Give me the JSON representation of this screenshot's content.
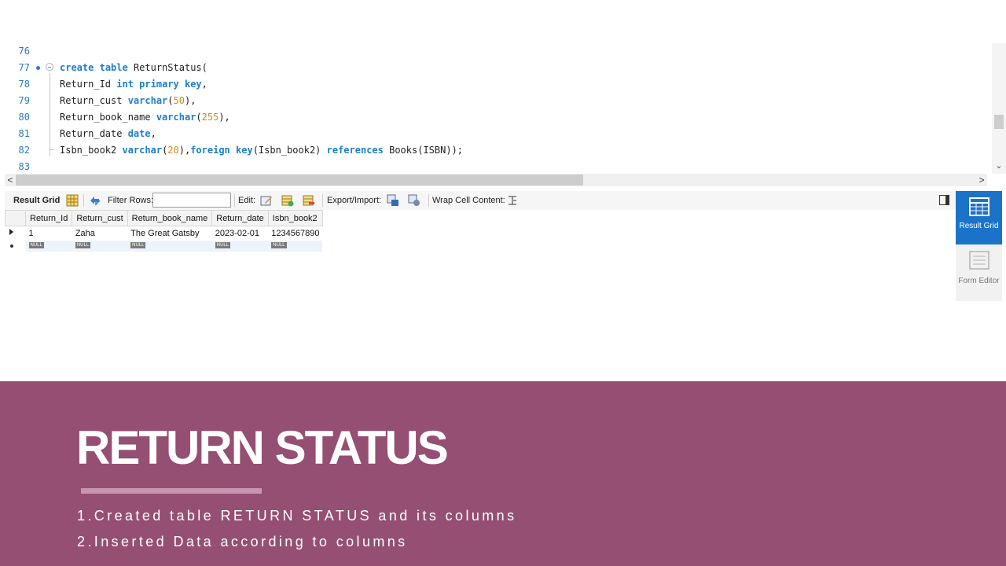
{
  "editor": {
    "lines": [
      {
        "num": "76",
        "parts": []
      },
      {
        "num": "77",
        "parts": [
          {
            "t": "create",
            "c": "kw"
          },
          {
            "t": " "
          },
          {
            "t": "table",
            "c": "kw"
          },
          {
            "t": " ReturnStatus("
          }
        ]
      },
      {
        "num": "78",
        "parts": [
          {
            "t": "Return_Id "
          },
          {
            "t": "int",
            "c": "kw"
          },
          {
            "t": " "
          },
          {
            "t": "primary",
            "c": "kw"
          },
          {
            "t": " "
          },
          {
            "t": "key",
            "c": "kw"
          },
          {
            "t": ","
          }
        ]
      },
      {
        "num": "79",
        "parts": [
          {
            "t": "Return_cust "
          },
          {
            "t": "varchar",
            "c": "kw"
          },
          {
            "t": "("
          },
          {
            "t": "50",
            "c": "num"
          },
          {
            "t": "),"
          }
        ]
      },
      {
        "num": "80",
        "parts": [
          {
            "t": "Return_book_name "
          },
          {
            "t": "varchar",
            "c": "kw"
          },
          {
            "t": "("
          },
          {
            "t": "255",
            "c": "num"
          },
          {
            "t": "),"
          }
        ]
      },
      {
        "num": "81",
        "parts": [
          {
            "t": "Return_date "
          },
          {
            "t": "date",
            "c": "kw"
          },
          {
            "t": ","
          }
        ]
      },
      {
        "num": "82",
        "parts": [
          {
            "t": "Isbn_book2 "
          },
          {
            "t": "varchar",
            "c": "kw"
          },
          {
            "t": "("
          },
          {
            "t": "20",
            "c": "num"
          },
          {
            "t": "),"
          },
          {
            "t": "foreign",
            "c": "kw"
          },
          {
            "t": " "
          },
          {
            "t": "key",
            "c": "kw"
          },
          {
            "t": "(Isbn_book2) "
          },
          {
            "t": "references",
            "c": "kw"
          },
          {
            "t": " Books(ISBN));"
          }
        ]
      },
      {
        "num": "83",
        "parts": []
      }
    ]
  },
  "scroll": {
    "left_arrow": "<",
    "right_arrow": ">",
    "down_arrow": "⌄"
  },
  "toolbar": {
    "result_grid_label": "Result Grid",
    "filter_rows_label": "Filter Rows:",
    "filter_value": "",
    "edit_label": "Edit:",
    "export_import_label": "Export/Import:",
    "wrap_label": "Wrap Cell Content:"
  },
  "grid": {
    "columns": [
      "Return_Id",
      "Return_cust",
      "Return_book_name",
      "Return_date",
      "Isbn_book2"
    ],
    "rows": [
      [
        "1",
        "Zaha",
        "The Great Gatsby",
        "2023-02-01",
        "1234567890"
      ]
    ],
    "null_label": "NULL"
  },
  "side_panel": {
    "result_grid": "Result Grid",
    "form_editor": "Form Editor"
  },
  "slide": {
    "title": "RETURN STATUS",
    "bullets": [
      "1.Created table RETURN STATUS and its columns",
      "2.Inserted Data according to columns"
    ]
  },
  "colors": {
    "banner": "#954f72",
    "rule": "#c895b0",
    "keyword": "#1f7ec8",
    "number": "#d08a1f",
    "side_active": "#1a73c9"
  }
}
